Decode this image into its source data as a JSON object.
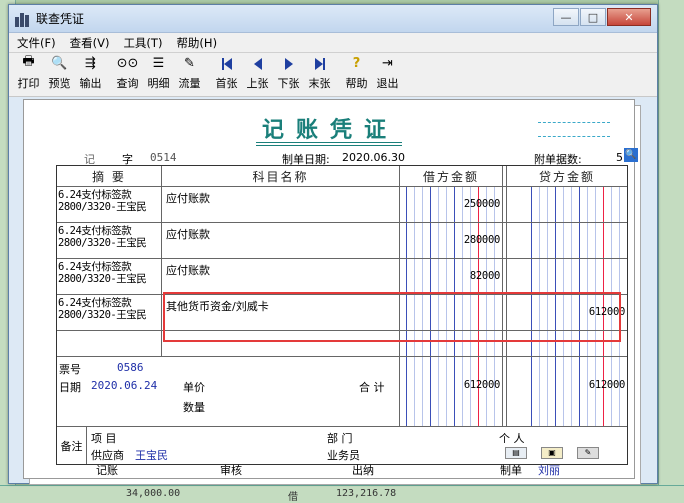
{
  "window": {
    "title": "联查凭证"
  },
  "menu": [
    "文件(F)",
    "查看(V)",
    "工具(T)",
    "帮助(H)"
  ],
  "toolbar": {
    "print": "打印",
    "preview": "预览",
    "export": "输出",
    "query": "查询",
    "detail": "明细",
    "flow": "流量",
    "first": "首张",
    "prev": "上张",
    "next": "下张",
    "last": "末张",
    "help": "帮助",
    "exit": "退出"
  },
  "voucher": {
    "title": "记账凭证",
    "type_label": "记",
    "zi_label": "字",
    "number": "0514",
    "date_label": "制单日期:",
    "date": "2020.06.30",
    "attach_label": "附单据数:",
    "attach_count": "5",
    "headers": {
      "summary": "摘 要",
      "account": "科目名称",
      "debit": "借方金额",
      "credit": "贷方金额"
    },
    "rows": [
      {
        "summary1": "6.24支付标签款",
        "summary2": "2800/3320-王宝民",
        "account": "应付账款",
        "debit": "250000",
        "credit": ""
      },
      {
        "summary1": "6.24支付标签款",
        "summary2": "2800/3320-王宝民",
        "account": "应付账款",
        "debit": "280000",
        "credit": ""
      },
      {
        "summary1": "6.24支付标签款",
        "summary2": "2800/3320-王宝民",
        "account": "应付账款",
        "debit": "82000",
        "credit": ""
      },
      {
        "summary1": "6.24支付标签款",
        "summary2": "2800/3320-王宝民",
        "account": "其他货币资金/刘威卡",
        "debit": "",
        "credit": "612000"
      }
    ],
    "ticket_label": "票号",
    "ticket_no": "0586",
    "ticket_date_label": "日期",
    "ticket_date": "2020.06.24",
    "price_label": "单价",
    "qty_label": "数量",
    "total_label": "合 计",
    "total_debit": "612000",
    "total_credit": "612000",
    "remark_label": "备注",
    "project_label": "项 目",
    "dept_label": "部 门",
    "person_label": "个 人",
    "supplier_label": "供应商",
    "supplier": "王宝民",
    "salesman_label": "业务员",
    "bookkeeping_label": "记账",
    "audit_label": "审核",
    "cashier_label": "出纳",
    "maker_label": "制单",
    "maker": "刘丽"
  },
  "background": {
    "bottom_amount1": "34,000.00",
    "bottom_label": "借",
    "bottom_amount2": "123,216.78"
  },
  "colors": {
    "accent": "#1a7f7a",
    "highlight": "#e43a3a",
    "blue_text": "#1f2fa8"
  }
}
